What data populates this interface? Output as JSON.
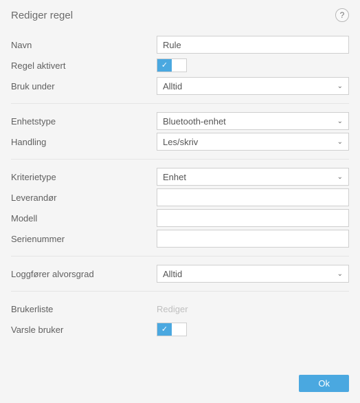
{
  "header": {
    "title": "Rediger regel",
    "help_label": "?"
  },
  "fields": {
    "name": {
      "label": "Navn",
      "value": "Rule"
    },
    "rule_enabled": {
      "label": "Regel aktivert",
      "checked": true
    },
    "use_during": {
      "label": "Bruk under",
      "value": "Alltid"
    },
    "device_type": {
      "label": "Enhetstype",
      "value": "Bluetooth-enhet"
    },
    "action": {
      "label": "Handling",
      "value": "Les/skriv"
    },
    "criteria_type": {
      "label": "Kriterietype",
      "value": "Enhet"
    },
    "vendor": {
      "label": "Leverandør",
      "value": ""
    },
    "model": {
      "label": "Modell",
      "value": ""
    },
    "serial_number": {
      "label": "Serienummer",
      "value": ""
    },
    "logging_severity": {
      "label": "Loggfører alvorsgrad",
      "value": "Alltid"
    },
    "user_list": {
      "label": "Brukerliste",
      "link": "Rediger"
    },
    "notify_user": {
      "label": "Varsle bruker",
      "checked": true
    }
  },
  "footer": {
    "ok_label": "Ok"
  }
}
